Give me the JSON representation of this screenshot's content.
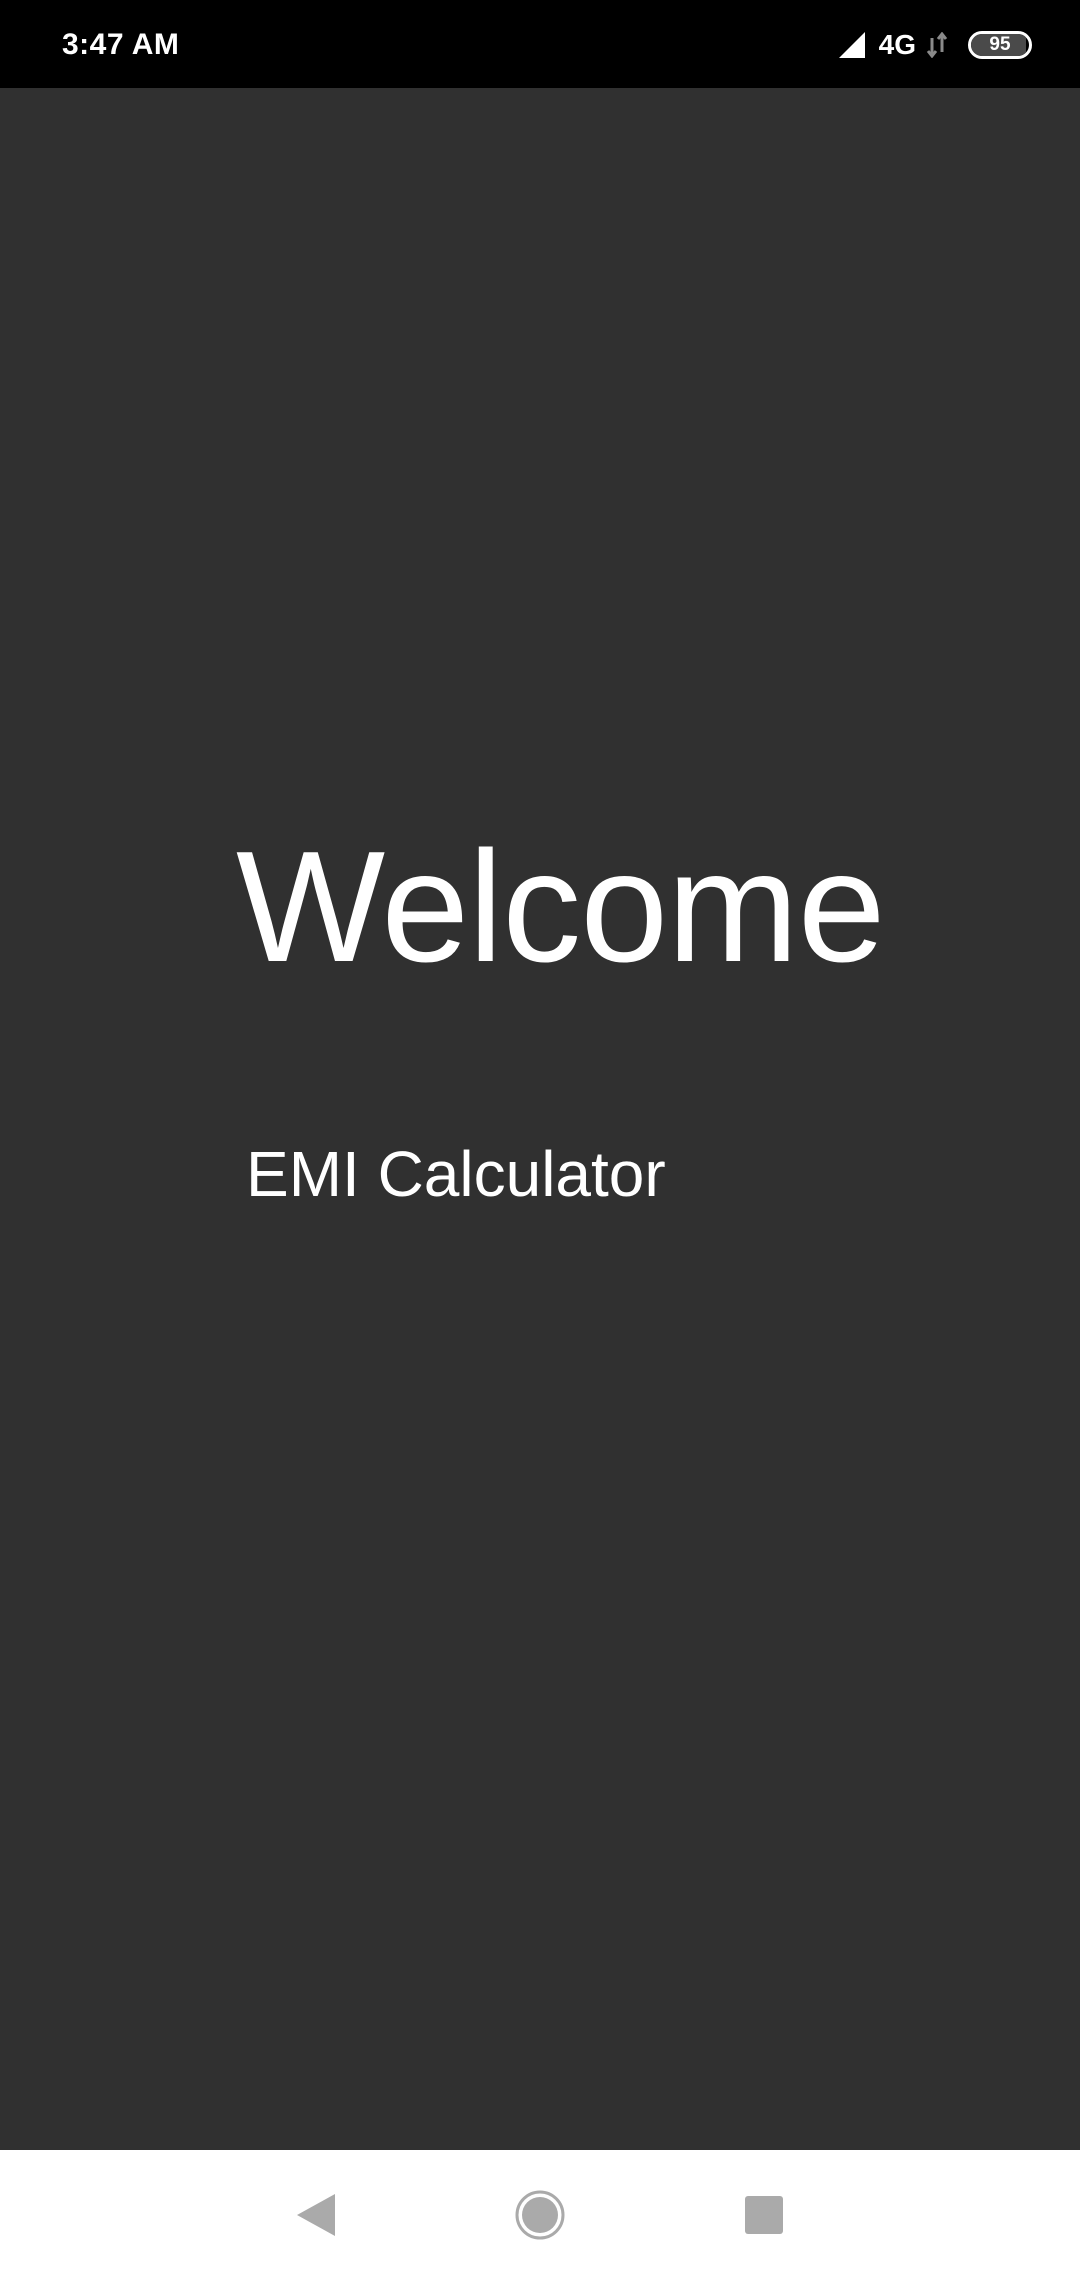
{
  "status_bar": {
    "time": "3:47 AM",
    "network": "4G",
    "battery_level": "95",
    "battery_fraction": 0.95,
    "icons": [
      "signal-icon",
      "data-transfer-icon",
      "battery-icon"
    ]
  },
  "main": {
    "title": "Welcome",
    "subtitle": "EMI Calculator"
  },
  "nav_bar": {
    "icons": [
      "back-icon",
      "home-icon",
      "recents-icon"
    ]
  },
  "colors": {
    "status_bar_bg": "#000000",
    "main_bg": "#303030",
    "text": "#ffffff",
    "nav_bar_bg": "#ffffff",
    "nav_icon": "#aaaaaa"
  }
}
